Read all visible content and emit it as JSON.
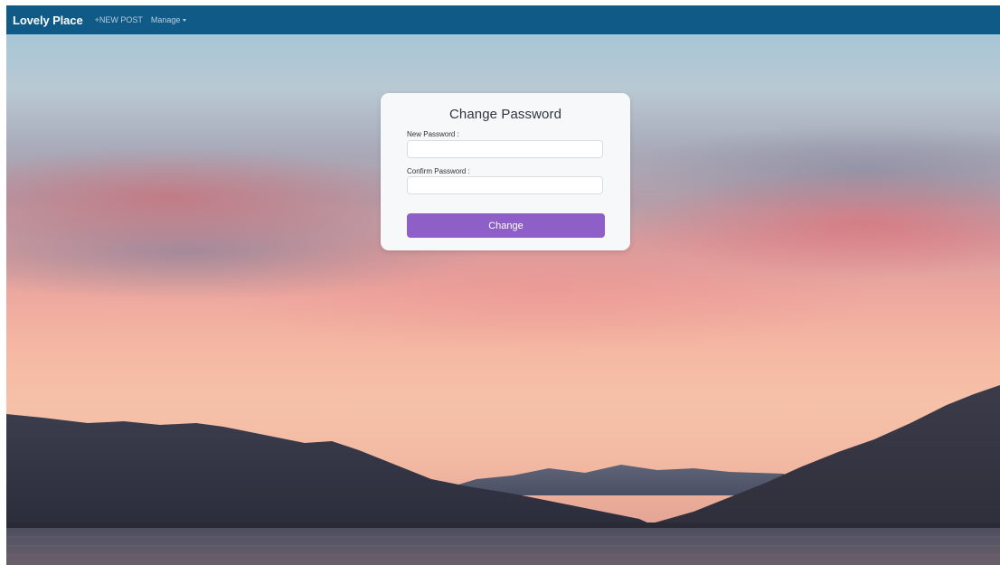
{
  "navbar": {
    "brand": "Lovely Place",
    "new_post": "+NEW POST",
    "manage": "Manage",
    "background_color": "#0f5a87"
  },
  "card": {
    "title": "Change Password",
    "new_password_label": "New Password :",
    "new_password_value": "",
    "confirm_password_label": "Confirm Password :",
    "confirm_password_value": "",
    "button_label": "Change",
    "button_color": "#8d5fc7"
  },
  "background": {
    "description_icon": "sunset-lake-mountains-image"
  }
}
